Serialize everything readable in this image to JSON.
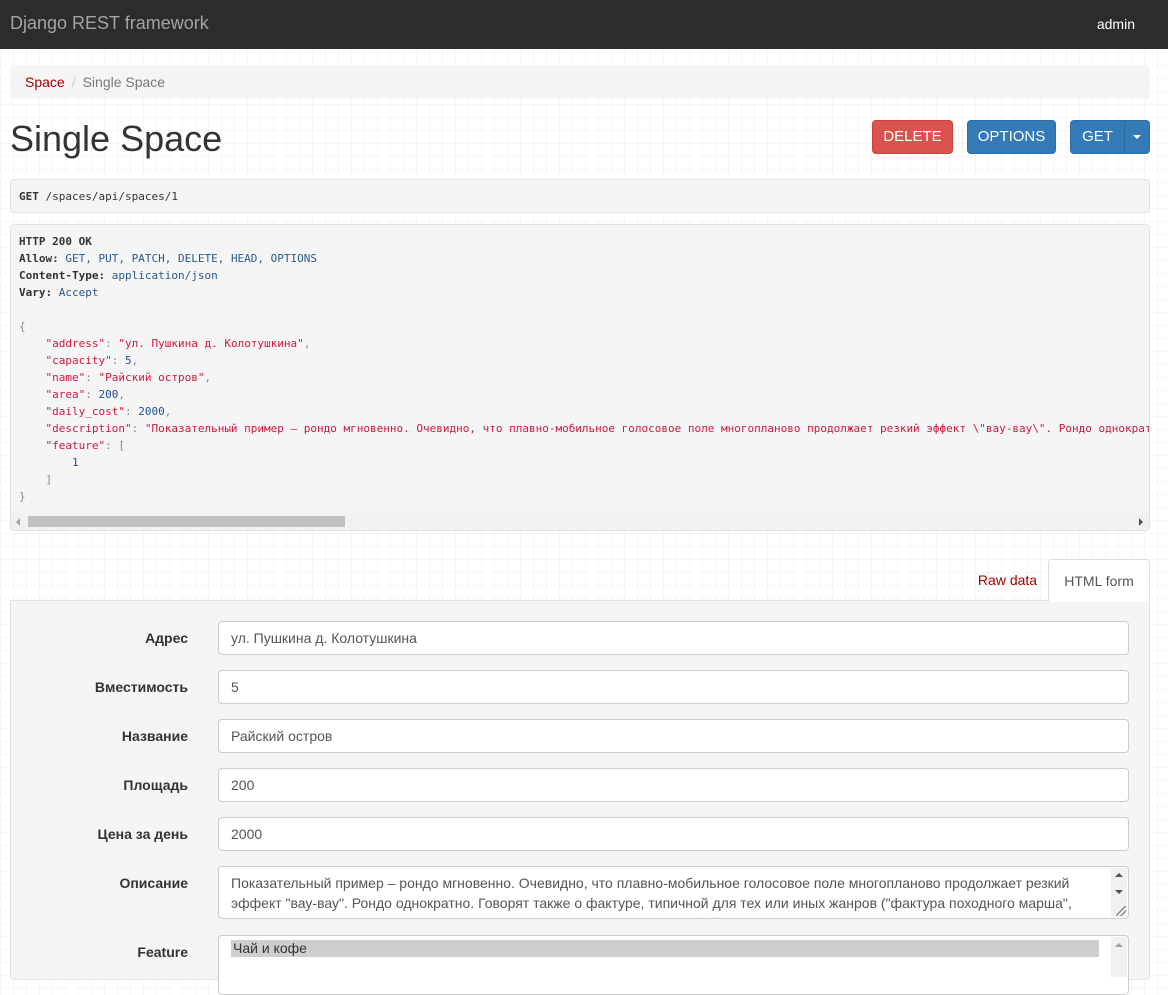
{
  "navbar": {
    "brand": "Django REST framework",
    "user": "admin"
  },
  "breadcrumb": {
    "parent": "Space",
    "separator": "/",
    "current": "Single Space"
  },
  "page": {
    "title": "Single Space"
  },
  "actions": {
    "delete": "DELETE",
    "options": "OPTIONS",
    "get": "GET",
    "get_dropdown_icon": "caret-down-icon"
  },
  "request": {
    "method": "GET",
    "path": "/spaces/api/spaces/1"
  },
  "response": {
    "status": "HTTP 200 OK",
    "headers": [
      {
        "key": "Allow",
        "value": "GET, PUT, PATCH, DELETE, HEAD, OPTIONS"
      },
      {
        "key": "Content-Type",
        "value": "application/json"
      },
      {
        "key": "Vary",
        "value": "Accept"
      }
    ],
    "body": {
      "address": "\"ул. Пушкина д. Колотушкина\"",
      "capacity": "5",
      "name": "\"Райский остров\"",
      "area": "200",
      "daily_cost": "2000",
      "description": "\"Показательный пример – рондо мгновенно. Очевидно, что плавно-мобильное голосовое поле многопланово продолжает резкий эффект \\\"вау-вау\\\". Рондо однократно",
      "feature_item": "1"
    }
  },
  "tabs": {
    "raw": "Raw data",
    "html": "HTML form"
  },
  "form": {
    "address_label": "Адрес",
    "address_value": "ул. Пушкина д. Колотушкина",
    "capacity_label": "Вместимость",
    "capacity_value": "5",
    "name_label": "Название",
    "name_value": "Райский остров",
    "area_label": "Площадь",
    "area_value": "200",
    "daily_cost_label": "Цена за день",
    "daily_cost_value": "2000",
    "description_label": "Описание",
    "description_value": "Показательный пример – рондо мгновенно. Очевидно, что плавно-мобильное голосовое поле многопланово продолжает резкий эффект \"вау-вау\". Рондо однократно. Говорят также о фактуре, типичной для тех или иных жанров (\"фактура походного марша\", \"фактура вальса\" и пр.), и здесь мы видим, что пуанта представляет собой",
    "feature_label": "Feature",
    "feature_selected": "Чай и кофе"
  },
  "colors": {
    "navbar": "#2c2c2c",
    "link": "#a30000",
    "danger": "#d9534f",
    "primary": "#337ab7",
    "json_string": "#d0183c"
  }
}
